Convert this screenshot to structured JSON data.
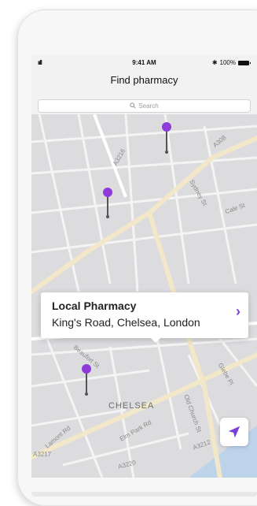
{
  "status_bar": {
    "signal": "ııll",
    "time": "9:41 AM",
    "bluetooth": "✱",
    "battery": "100%"
  },
  "header": {
    "title": "Find pharmacy"
  },
  "search": {
    "placeholder": "Search"
  },
  "map": {
    "district": "CHELSEA",
    "street_labels": [
      "A3216",
      "A308",
      "Cale St",
      "Sydney St",
      "Beaufort St",
      "Glebe Pl",
      "Old Church St",
      "Lamont Rd",
      "A3212",
      "A3220",
      "A3217",
      "Elm Park Rd"
    ]
  },
  "pharmacy_card": {
    "name": "Local Pharmacy",
    "address": "King's Road, Chelsea, London",
    "chevron": "›"
  },
  "colors": {
    "accent": "#7a3fd6",
    "pin": "#8e3bd9",
    "map_bg": "#d9d9db",
    "river": "#bcd3ea"
  },
  "icons": {
    "search": "search-icon",
    "chevron": "chevron-right-icon",
    "location": "location-arrow-icon"
  }
}
